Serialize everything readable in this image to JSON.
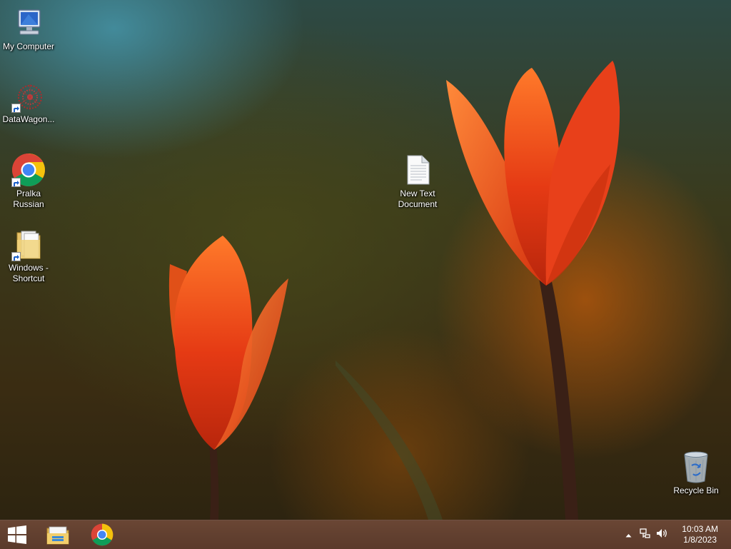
{
  "desktop": {
    "icons": [
      {
        "label": "My Computer",
        "icon": "computer-icon"
      },
      {
        "label": "DataWagon...",
        "icon": "datawagon-app-icon"
      },
      {
        "label": "Pralka Russian",
        "icon": "chrome-icon"
      },
      {
        "label": "Windows - Shortcut",
        "icon": "folder-icon"
      },
      {
        "label": "New Text Document",
        "icon": "text-document-icon"
      },
      {
        "label": "Recycle Bin",
        "icon": "recycle-bin-icon"
      }
    ]
  },
  "taskbar": {
    "start_icon": "windows-logo-icon",
    "pinned": [
      {
        "name": "File Explorer",
        "icon": "file-explorer-icon"
      },
      {
        "name": "Google Chrome",
        "icon": "chrome-icon"
      }
    ],
    "tray": {
      "chevron_icon": "show-hidden-icons-icon",
      "network_icon": "network-icon",
      "volume_icon": "volume-icon",
      "time": "10:03 AM",
      "date": "1/8/2023"
    }
  },
  "colors": {
    "taskbar": "#5e3e2e",
    "tulip": "#e8401a"
  }
}
